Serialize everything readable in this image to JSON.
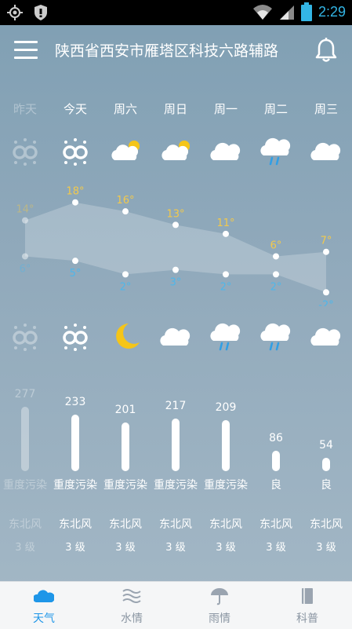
{
  "status_bar": {
    "time": "2:29"
  },
  "header": {
    "title": "陕西省西安市雁塔区科技六路辅路"
  },
  "colors": {
    "temp_high": "#f2c94c",
    "temp_low": "#4fb6ea",
    "nav_active": "#1e96e8",
    "nav_inactive": "#8b96a3",
    "sun": "#f5c518"
  },
  "days": [
    {
      "label": "昨天",
      "day_icon": "clear-night-icon",
      "night_icon": "clear-night-icon",
      "aqi": "277",
      "aqi_fraction": 0.34,
      "aqi_label": "重度污染",
      "wind_dir": "东北风",
      "wind_level": "3 级"
    },
    {
      "label": "今天",
      "day_icon": "clear-night-icon",
      "night_icon": "clear-night-icon",
      "aqi": "233",
      "aqi_fraction": 0.3,
      "aqi_label": "重度污染",
      "wind_dir": "东北风",
      "wind_level": "3 级"
    },
    {
      "label": "周六",
      "day_icon": "partly-cloudy-icon",
      "night_icon": "moon-icon",
      "aqi": "201",
      "aqi_fraction": 0.26,
      "aqi_label": "重度污染",
      "wind_dir": "东北风",
      "wind_level": "3 级"
    },
    {
      "label": "周日",
      "day_icon": "partly-cloudy-icon",
      "night_icon": "cloudy-icon",
      "aqi": "217",
      "aqi_fraction": 0.28,
      "aqi_label": "重度污染",
      "wind_dir": "东北风",
      "wind_level": "3 级"
    },
    {
      "label": "周一",
      "day_icon": "cloudy-icon",
      "night_icon": "rain-icon",
      "aqi": "209",
      "aqi_fraction": 0.27,
      "aqi_label": "重度污染",
      "wind_dir": "东北风",
      "wind_level": "3 级"
    },
    {
      "label": "周二",
      "day_icon": "rain-icon",
      "night_icon": "rain-icon",
      "aqi": "86",
      "aqi_fraction": 0.11,
      "aqi_label": "良",
      "wind_dir": "东北风",
      "wind_level": "3 级"
    },
    {
      "label": "周三",
      "day_icon": "cloudy-icon",
      "night_icon": "cloudy-icon",
      "aqi": "54",
      "aqi_fraction": 0.07,
      "aqi_label": "良",
      "wind_dir": "东北风",
      "wind_level": "3 级"
    }
  ],
  "chart_data": {
    "type": "area",
    "categories": [
      "昨天",
      "今天",
      "周六",
      "周日",
      "周一",
      "周二",
      "周三"
    ],
    "series": [
      {
        "values": [
          14,
          18,
          16,
          13,
          11,
          6,
          7
        ],
        "labels": [
          "14°",
          "18°",
          "16°",
          "13°",
          "11°",
          "6°",
          "7°"
        ]
      },
      {
        "values": [
          6,
          5,
          2,
          3,
          2,
          2,
          -2
        ],
        "labels": [
          "6°",
          "5°",
          "2°",
          "3°",
          "2°",
          "2°",
          "-2°"
        ]
      }
    ],
    "ylim": [
      -3,
      19
    ]
  },
  "nav": [
    {
      "label": "天气",
      "icon": "cloud-icon",
      "active": true
    },
    {
      "label": "水情",
      "icon": "waves-icon",
      "active": false
    },
    {
      "label": "雨情",
      "icon": "umbrella-icon",
      "active": false
    },
    {
      "label": "科普",
      "icon": "book-icon",
      "active": false
    }
  ]
}
